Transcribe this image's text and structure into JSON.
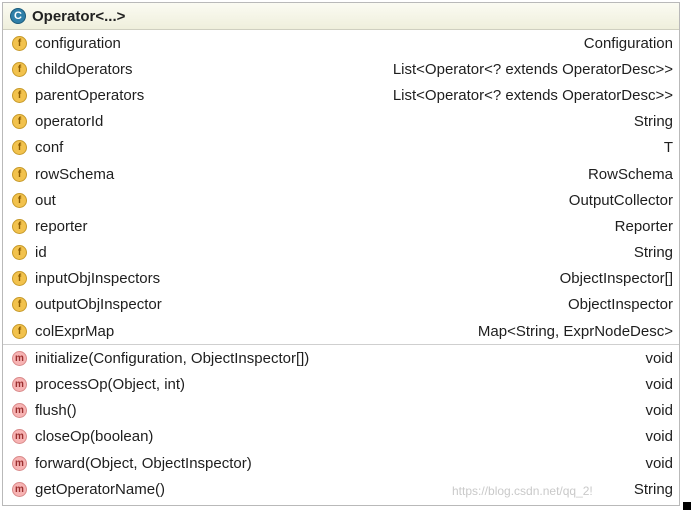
{
  "header": {
    "icon": "C",
    "title": "Operator<...>"
  },
  "fields": [
    {
      "icon": "f",
      "name": "configuration",
      "type": "Configuration"
    },
    {
      "icon": "f",
      "name": "childOperators",
      "type": "List<Operator<? extends OperatorDesc>>"
    },
    {
      "icon": "f",
      "name": "parentOperators",
      "type": "List<Operator<? extends OperatorDesc>>"
    },
    {
      "icon": "f",
      "name": "operatorId",
      "type": "String"
    },
    {
      "icon": "f",
      "name": "conf",
      "type": "T"
    },
    {
      "icon": "f",
      "name": "rowSchema",
      "type": "RowSchema"
    },
    {
      "icon": "f",
      "name": "out",
      "type": "OutputCollector"
    },
    {
      "icon": "f",
      "name": "reporter",
      "type": "Reporter"
    },
    {
      "icon": "f",
      "name": "id",
      "type": "String"
    },
    {
      "icon": "f",
      "name": "inputObjInspectors",
      "type": "ObjectInspector[]"
    },
    {
      "icon": "f",
      "name": "outputObjInspector",
      "type": "ObjectInspector"
    },
    {
      "icon": "f",
      "name": "colExprMap",
      "type": "Map<String, ExprNodeDesc>"
    }
  ],
  "methods": [
    {
      "icon": "m",
      "name": "initialize(Configuration, ObjectInspector[])",
      "type": "void"
    },
    {
      "icon": "m",
      "name": "processOp(Object, int)",
      "type": "void"
    },
    {
      "icon": "m",
      "name": "flush()",
      "type": "void"
    },
    {
      "icon": "m",
      "name": "closeOp(boolean)",
      "type": "void"
    },
    {
      "icon": "m",
      "name": "forward(Object, ObjectInspector)",
      "type": "void"
    },
    {
      "icon": "m",
      "name": "getOperatorName()",
      "type": "String"
    }
  ],
  "watermark": "https://blog.csdn.net/qq_2!"
}
